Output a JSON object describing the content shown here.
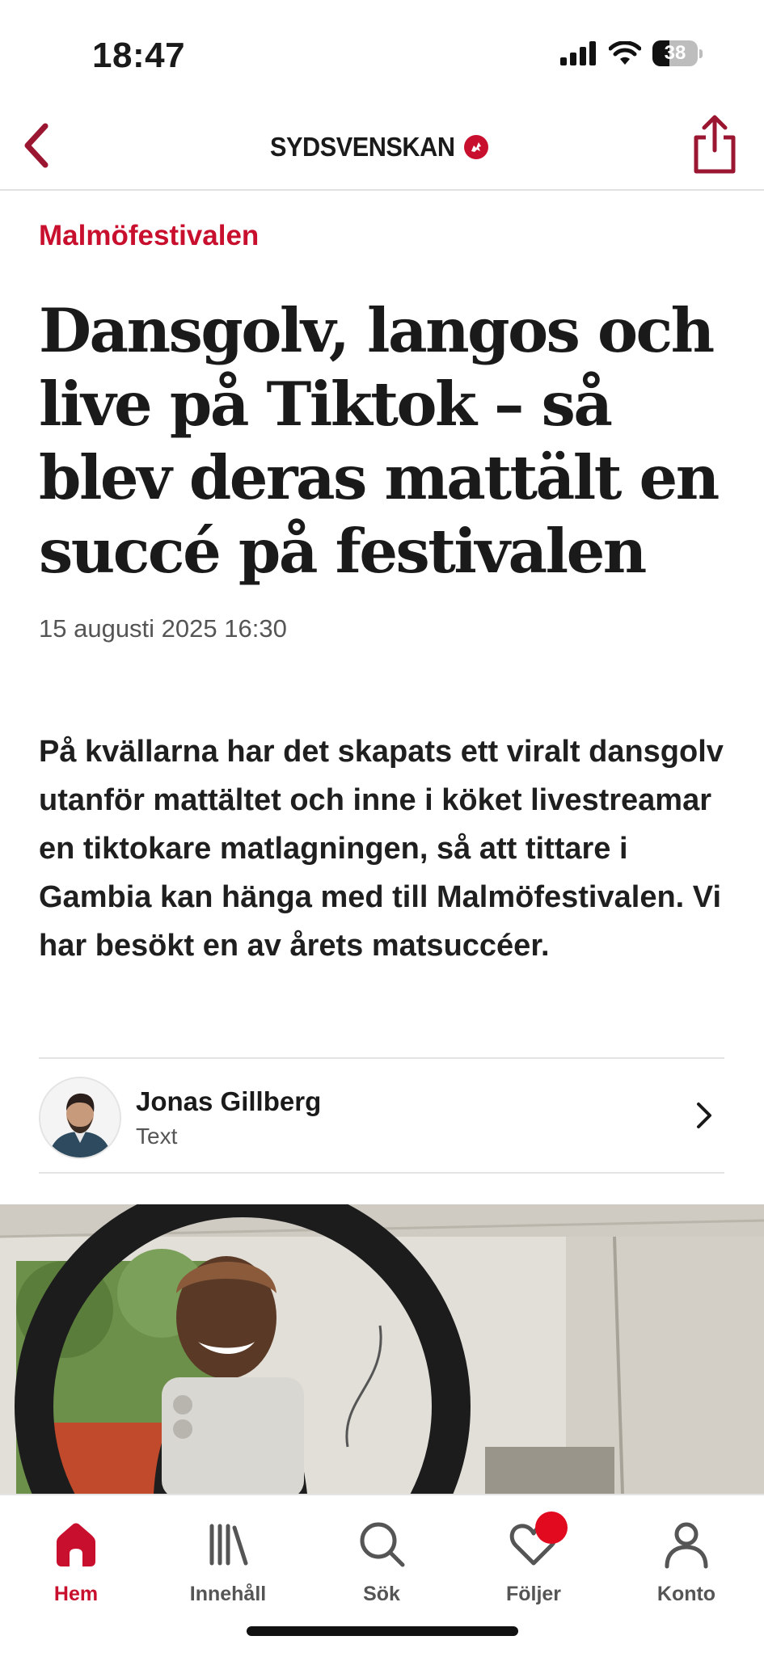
{
  "status_bar": {
    "time": "18:47",
    "battery_level": "38",
    "battery_fraction": 0.38
  },
  "nav": {
    "back_icon": "chevron-left-icon",
    "logo_text": "SYDSVENSKAN",
    "share_icon": "share-icon"
  },
  "article": {
    "kicker": "Malmöfestivalen",
    "headline": "Dansgolv, langos och live på Tiktok – så blev deras mattält en succé på festivalen",
    "date": "15 augusti 2025 16:30",
    "lead": "På kvällarna har det skapats ett viralt dansgolv utanför mattältet och inne i köket livestreamar en tiktokare matlagningen, så att tittare i Gambia kan hänga med till Malmöfestivalen. Vi har besökt en av årets matsuccéer."
  },
  "byline": {
    "name": "Jonas Gillberg",
    "role": "Text"
  },
  "colors": {
    "accent": "#c8102e",
    "text": "#1a1a1a",
    "muted": "#555555",
    "badge": "#e10a1e"
  },
  "tabbar": {
    "tabs": [
      {
        "label": "Hem",
        "icon": "home-icon",
        "active": true
      },
      {
        "label": "Innehåll",
        "icon": "library-icon",
        "active": false
      },
      {
        "label": "Sök",
        "icon": "search-icon",
        "active": false
      },
      {
        "label": "Följer",
        "icon": "heart-icon",
        "active": false,
        "badge": true
      },
      {
        "label": "Konto",
        "icon": "person-icon",
        "active": false
      }
    ]
  }
}
